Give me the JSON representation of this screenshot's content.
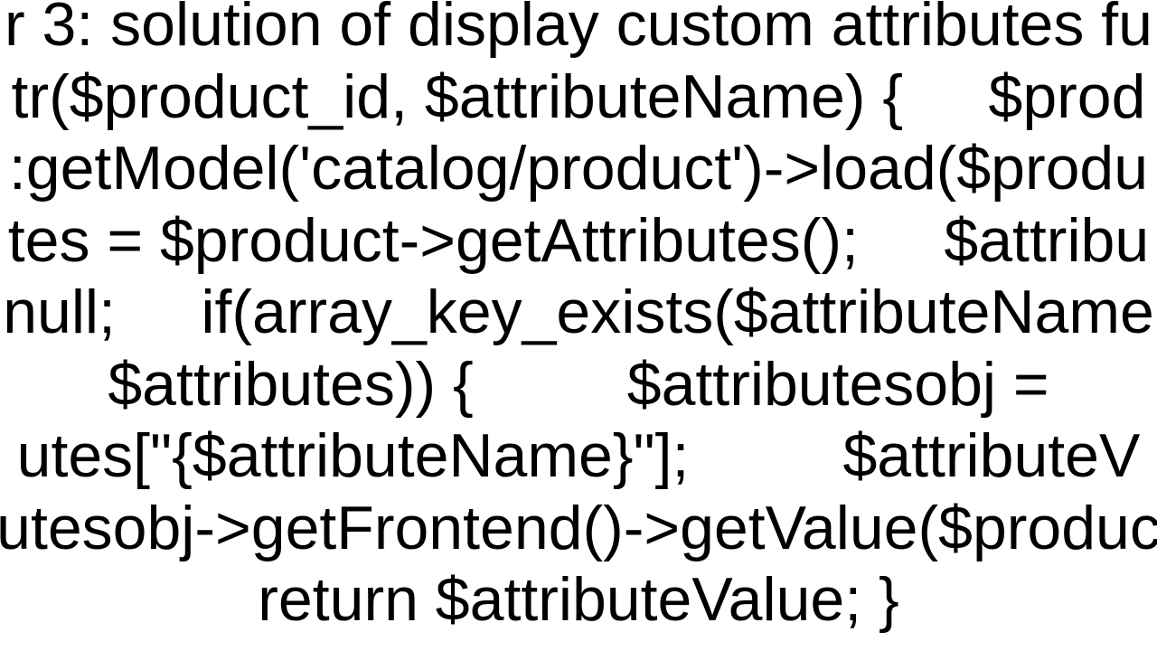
{
  "code_text": "r 3: solution of display custom attributes fu\ntr($product_id, $attributeName) {     $prod\n:getModel('catalog/product')->load($produ\ntes = $product->getAttributes();     $attribu\nnull;     if(array_key_exists($attributeName\n$attributes)) {         $attributesobj =\nutes[\"{$attributeName}\"];         $attributeV\nutesobj->getFrontend()->getValue($produc\nreturn $attributeValue; }"
}
